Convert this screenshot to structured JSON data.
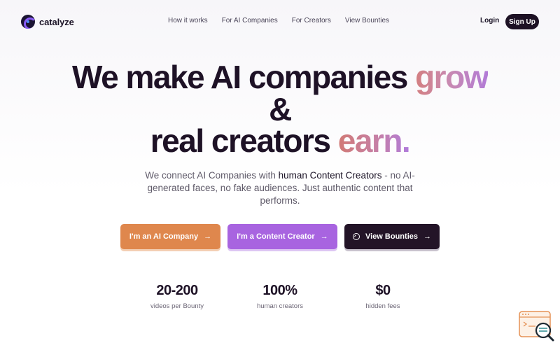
{
  "brand": {
    "name": "catalyze",
    "logo_icon": "catalyze-logo-icon"
  },
  "nav": {
    "links": [
      "How it works",
      "For AI Companies",
      "For Creators",
      "View Bounties"
    ],
    "login": "Login",
    "signup": "Sign Up"
  },
  "hero": {
    "line1_plain": "We make AI companies ",
    "line1_accent": "grow",
    "line2": "&",
    "line3_plain": "real creators ",
    "line3_accent": "earn."
  },
  "subtitle": {
    "part1": "We connect AI Companies with ",
    "bold": "human Content Creators",
    "part2": " - no AI-generated faces, no fake audiences. Just authentic content that performs."
  },
  "cta": {
    "ai_company": "I'm an AI Company",
    "creator": "I'm a Content Creator",
    "bounties": "View Bounties",
    "arrow": "→"
  },
  "stats": [
    {
      "value": "20-200",
      "label": "videos per Bounty"
    },
    {
      "value": "100%",
      "label": "human creators"
    },
    {
      "value": "$0",
      "label": "hidden fees"
    }
  ],
  "colors": {
    "primary_dark": "#1d1124",
    "orange": "#df874d",
    "purple": "#a864e0",
    "accent_gradient_start": "#d37f80",
    "accent_gradient_end": "#b27bd7"
  }
}
